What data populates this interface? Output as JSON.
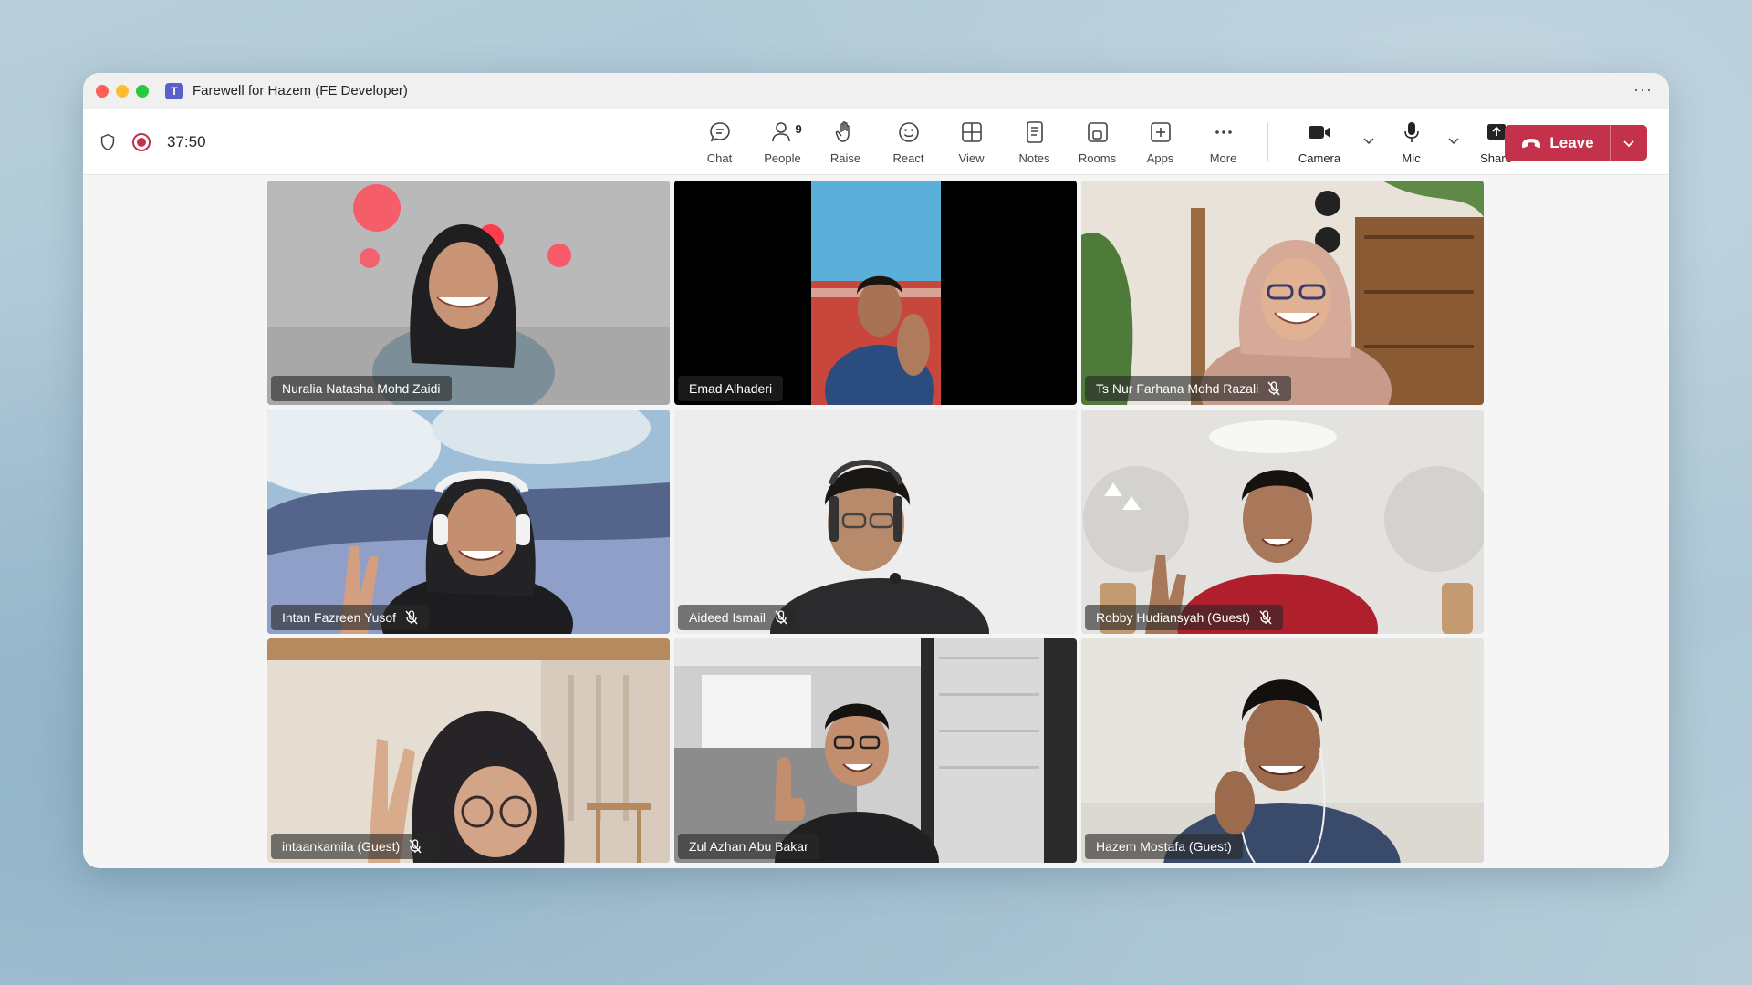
{
  "window": {
    "title": "Farewell for Hazem (FE Developer)"
  },
  "toolbar": {
    "timer": "37:50",
    "controls": [
      {
        "label": "Chat",
        "icon": "chat-icon"
      },
      {
        "label": "People",
        "icon": "people-icon",
        "badge": "9"
      },
      {
        "label": "Raise",
        "icon": "raise-hand-icon"
      },
      {
        "label": "React",
        "icon": "smile-icon"
      },
      {
        "label": "View",
        "icon": "grid-icon"
      },
      {
        "label": "Notes",
        "icon": "notes-icon"
      },
      {
        "label": "Rooms",
        "icon": "rooms-icon"
      },
      {
        "label": "Apps",
        "icon": "plus-box-icon"
      },
      {
        "label": "More",
        "icon": "more-icon"
      }
    ],
    "camera": {
      "label": "Camera",
      "icon": "camera-icon"
    },
    "mic": {
      "label": "Mic",
      "icon": "mic-icon"
    },
    "share": {
      "label": "Share",
      "icon": "share-icon"
    },
    "leave": {
      "label": "Leave",
      "icon": "phone-hangup-icon"
    }
  },
  "participants": [
    {
      "name": "Nuralia Natasha Mohd Zaidi",
      "muted": false,
      "active": false
    },
    {
      "name": "Emad Alhaderi",
      "muted": false,
      "active": false
    },
    {
      "name": "Ts Nur Farhana Mohd Razali",
      "muted": true,
      "active": false
    },
    {
      "name": "Intan Fazreen Yusof",
      "muted": true,
      "active": false
    },
    {
      "name": "Aideed Ismail",
      "muted": true,
      "active": false
    },
    {
      "name": "Robby Hudiansyah (Guest)",
      "muted": true,
      "active": false
    },
    {
      "name": "intaankamila (Guest)",
      "muted": true,
      "active": false
    },
    {
      "name": "Zul Azhan Abu Bakar",
      "muted": false,
      "active": true
    },
    {
      "name": "Hazem Mostafa (Guest)",
      "muted": false,
      "active": true
    }
  ],
  "colors": {
    "leave": "#c4314b",
    "accent": "#6264a7",
    "record": "#c4314b"
  }
}
